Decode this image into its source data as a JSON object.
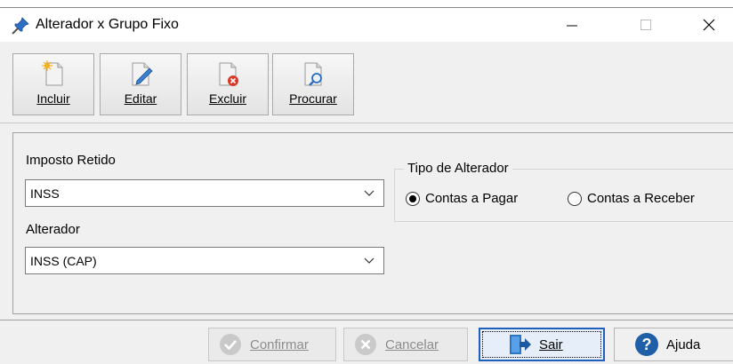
{
  "window": {
    "title": "Alterador x Grupo Fixo"
  },
  "toolbar": {
    "buttons": [
      {
        "label": "Incluir",
        "icon": "new-document-icon"
      },
      {
        "label": "Editar",
        "icon": "edit-document-icon"
      },
      {
        "label": "Excluir",
        "icon": "delete-document-icon"
      },
      {
        "label": "Procurar",
        "icon": "search-document-icon"
      }
    ]
  },
  "form": {
    "imposto_label": "Imposto Retido",
    "imposto_value": "INSS",
    "alterador_label": "Alterador",
    "alterador_value": "INSS (CAP)",
    "tipo_label": "Tipo de Alterador",
    "tipo_options": [
      {
        "label": "Contas a Pagar",
        "selected": true
      },
      {
        "label": "Contas a Receber",
        "selected": false
      }
    ]
  },
  "actions": {
    "confirmar": "Confirmar",
    "cancelar": "Cancelar",
    "sair": "Sair",
    "ajuda": "Ajuda"
  },
  "colors": {
    "help_blue": "#1e5fa8",
    "exit_blue": "#2a76c6",
    "delete_red": "#d83a2a"
  }
}
